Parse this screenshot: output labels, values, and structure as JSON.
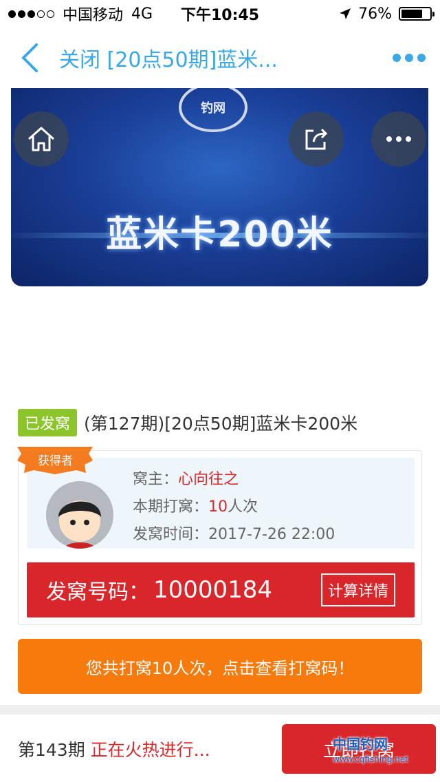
{
  "status_bar": {
    "carrier": "中国移动",
    "network": "4G",
    "time": "下午10:45",
    "battery_percent": "76%",
    "battery_level": 0.76
  },
  "nav": {
    "title": "关闭 [20点50期]蓝米..."
  },
  "banner": {
    "text": "蓝米卡200米",
    "logo_text": "钓网"
  },
  "item": {
    "tag": "已发窝",
    "title": "(第127期)[20点50期]蓝米卡200米"
  },
  "winner": {
    "ribbon_label": "获得者",
    "owner_label": "窝主：",
    "owner_name": "心向往之",
    "times_label": "本期打窝：",
    "times_value": "10",
    "times_unit": "人次",
    "time_label": "发窝时间：",
    "time_value": "2017-7-26 22:00"
  },
  "code": {
    "label": "发窝号码：",
    "value": "10000184",
    "calc_button": "计算详情"
  },
  "cta": {
    "label": "您共打窝10人次，点击查看打窝码！"
  },
  "bottom": {
    "period": "第143期",
    "status": "正在火热进行...",
    "join_button": "立即打窝"
  },
  "watermark": {
    "text": "中国钓网",
    "url": "www.cqfishing.net"
  },
  "colors": {
    "accent_blue": "#3aa8e6",
    "tag_green": "#8cc42b",
    "code_red": "#d8262a",
    "cta_orange": "#f77a0c"
  }
}
